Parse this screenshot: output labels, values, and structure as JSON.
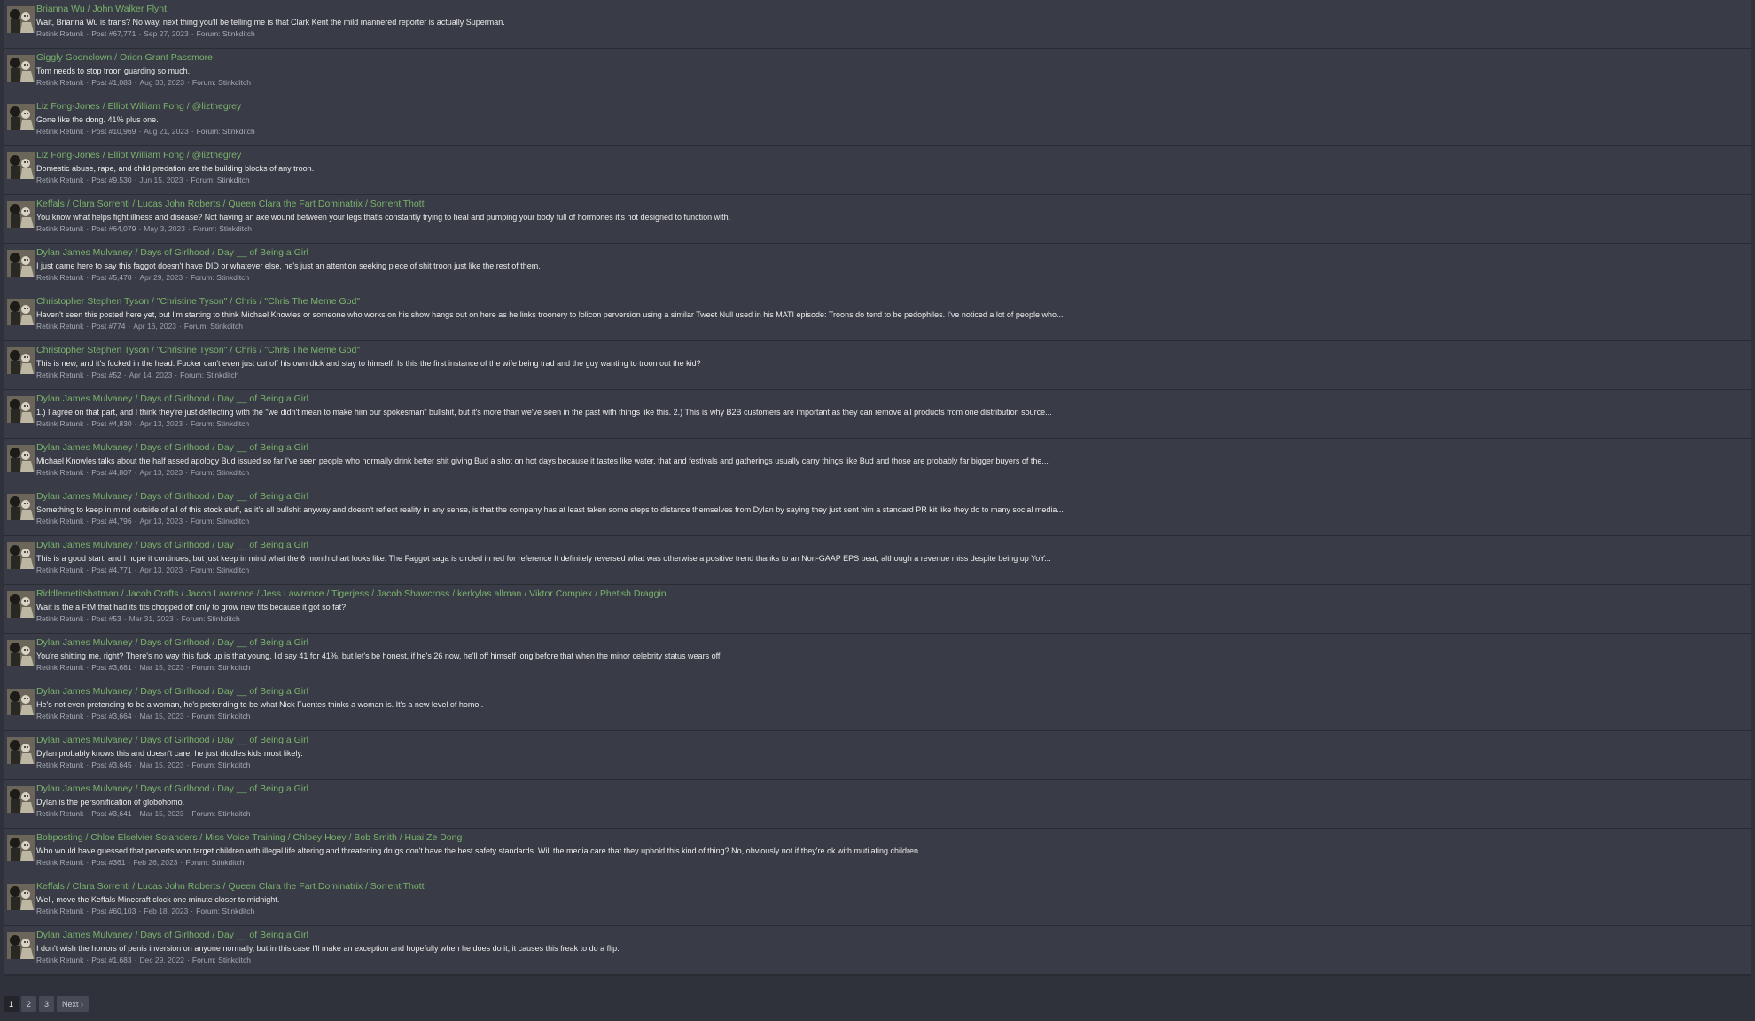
{
  "results": [
    {
      "title": "Brianna Wu / John Walker Flynt",
      "snippet": "Wait, Brianna Wu is trans? No way, next thing you'll be telling me is that Clark Kent the mild mannered reporter is actually Superman.",
      "author": "Retink Retunk",
      "post": "Post #67,771",
      "date": "Sep 27, 2023",
      "forum": "Forum: Stinkditch"
    },
    {
      "title": "Giggly Goonclown / Orion Grant Passmore",
      "snippet": "Tom needs to stop troon guarding so much.",
      "author": "Retink Retunk",
      "post": "Post #1,083",
      "date": "Aug 30, 2023",
      "forum": "Forum: Stinkditch"
    },
    {
      "title": "Liz Fong-Jones / Elliot William Fong / @lizthegrey",
      "snippet": "Gone like the dong. 41% plus one.",
      "author": "Retink Retunk",
      "post": "Post #10,969",
      "date": "Aug 21, 2023",
      "forum": "Forum: Stinkditch"
    },
    {
      "title": "Liz Fong-Jones / Elliot William Fong / @lizthegrey",
      "snippet": "Domestic abuse, rape, and child predation are the building blocks of any troon.",
      "author": "Retink Retunk",
      "post": "Post #9,530",
      "date": "Jun 15, 2023",
      "forum": "Forum: Stinkditch"
    },
    {
      "title": "Keffals / Clara Sorrenti / Lucas John Roberts / Queen Clara the Fart Dominatrix / SorrentiThott",
      "snippet": "You know what helps fight illness and disease? Not having an axe wound between your legs that's constantly trying to heal and pumping your body full of hormones it's not designed to function with.",
      "author": "Retink Retunk",
      "post": "Post #64,079",
      "date": "May 3, 2023",
      "forum": "Forum: Stinkditch"
    },
    {
      "title": "Dylan James Mulvaney / Days of Girlhood / Day __ of Being a Girl",
      "snippet": "I just came here to say this faggot doesn't have DID or whatever else, he's just an attention seeking piece of shit troon just like the rest of them.",
      "author": "Retink Retunk",
      "post": "Post #5,478",
      "date": "Apr 29, 2023",
      "forum": "Forum: Stinkditch"
    },
    {
      "title": "Christopher Stephen Tyson / \"Christine Tyson\" / Chris / \"Chris The Meme God\"",
      "snippet": "Haven't seen this posted here yet, but I'm starting to think Michael Knowles or someone who works on his show hangs out on here as he links troonery to lolicon perversion using a similar Tweet Null used in his MATI episode: Troons do tend to be pedophiles. I've noticed a lot of people who...",
      "author": "Retink Retunk",
      "post": "Post #774",
      "date": "Apr 16, 2023",
      "forum": "Forum: Stinkditch"
    },
    {
      "title": "Christopher Stephen Tyson / \"Christine Tyson\" / Chris / \"Chris The Meme God\"",
      "snippet": "This is new, and it's fucked in the head. Fucker can't even just cut off his own dick and stay to himself. Is this the first instance of the wife being trad and the guy wanting to troon out the kid?",
      "author": "Retink Retunk",
      "post": "Post #52",
      "date": "Apr 14, 2023",
      "forum": "Forum: Stinkditch"
    },
    {
      "title": "Dylan James Mulvaney / Days of Girlhood / Day __ of Being a Girl",
      "snippet": "1.) I agree on that part, and I think they're just deflecting with the \"we didn't mean to make him our spokesman\" bullshit, but it's more than we've seen in the past with things like this. 2.) This is why B2B customers are important as they can remove all products from one distribution source...",
      "author": "Retink Retunk",
      "post": "Post #4,830",
      "date": "Apr 13, 2023",
      "forum": "Forum: Stinkditch"
    },
    {
      "title": "Dylan James Mulvaney / Days of Girlhood / Day __ of Being a Girl",
      "snippet": "Michael Knowles talks about the half assed apology Bud issued so far I've seen people who normally drink better shit giving Bud a shot on hot days because it tastes like water, that and festivals and gatherings usually carry things like Bud and those are probably far bigger buyers of the...",
      "author": "Retink Retunk",
      "post": "Post #4,807",
      "date": "Apr 13, 2023",
      "forum": "Forum: Stinkditch"
    },
    {
      "title": "Dylan James Mulvaney / Days of Girlhood / Day __ of Being a Girl",
      "snippet": "Something to keep in mind outside of all of this stock stuff, as it's all bullshit anyway and doesn't reflect reality in any sense, is that the company has at least taken some steps to distance themselves from Dylan by saying they just sent him a standard PR kit like they do to many social media...",
      "author": "Retink Retunk",
      "post": "Post #4,796",
      "date": "Apr 13, 2023",
      "forum": "Forum: Stinkditch"
    },
    {
      "title": "Dylan James Mulvaney / Days of Girlhood / Day __ of Being a Girl",
      "snippet": "This is a good start, and I hope it continues, but just keep in mind what the 6 month chart looks like. The Faggot saga is circled in red for reference It definitely reversed what was otherwise a positive trend thanks to an Non-GAAP EPS beat, although a revenue miss despite being up YoY...",
      "author": "Retink Retunk",
      "post": "Post #4,771",
      "date": "Apr 13, 2023",
      "forum": "Forum: Stinkditch"
    },
    {
      "title": "Riddlemetitsbatman / Jacob Crafts / Jacob Lawrence / Jess Lawrence / Tigerjess / Jacob Shawcross / kerkylas allman / Viktor Complex / Phetish Draggin",
      "snippet": "Wait is the a FtM that had its tits chopped off only to grow new tits because it got so fat?",
      "author": "Retink Retunk",
      "post": "Post #53",
      "date": "Mar 31, 2023",
      "forum": "Forum: Stinkditch"
    },
    {
      "title": "Dylan James Mulvaney / Days of Girlhood / Day __ of Being a Girl",
      "snippet": "You're shitting me, right? There's no way this fuck up is that young. I'd say 41 for 41%, but let's be honest, if he's 26 now, he'll off himself long before that when the minor celebrity status wears off.",
      "author": "Retink Retunk",
      "post": "Post #3,681",
      "date": "Mar 15, 2023",
      "forum": "Forum: Stinkditch"
    },
    {
      "title": "Dylan James Mulvaney / Days of Girlhood / Day __ of Being a Girl",
      "snippet": "He's not even pretending to be a woman, he's pretending to be what Nick Fuentes thinks a woman is. It's a new level of homo..",
      "author": "Retink Retunk",
      "post": "Post #3,664",
      "date": "Mar 15, 2023",
      "forum": "Forum: Stinkditch"
    },
    {
      "title": "Dylan James Mulvaney / Days of Girlhood / Day __ of Being a Girl",
      "snippet": "Dylan probably knows this and doesn't care, he just diddles kids most likely.",
      "author": "Retink Retunk",
      "post": "Post #3,645",
      "date": "Mar 15, 2023",
      "forum": "Forum: Stinkditch"
    },
    {
      "title": "Dylan James Mulvaney / Days of Girlhood / Day __ of Being a Girl",
      "snippet": "Dylan is the personification of globohomo.",
      "author": "Retink Retunk",
      "post": "Post #3,641",
      "date": "Mar 15, 2023",
      "forum": "Forum: Stinkditch"
    },
    {
      "title": "Bobposting / Chloe Elselvier Solanders / Miss Voice Training / Chloey Hoey / Bob Smith / Huai Ze Dong",
      "snippet": "Who would have guessed that perverts who target children with illegal life altering and threatening drugs don't have the best safety standards. Will the media care that they uphold this kind of thing? No, obviously not if they're ok with mutilating children.",
      "author": "Retink Retunk",
      "post": "Post #361",
      "date": "Feb 26, 2023",
      "forum": "Forum: Stinkditch"
    },
    {
      "title": "Keffals / Clara Sorrenti / Lucas John Roberts / Queen Clara the Fart Dominatrix / SorrentiThott",
      "snippet": "Well, move the Keffals Minecraft clock one minute closer to midnight.",
      "author": "Retink Retunk",
      "post": "Post #60,103",
      "date": "Feb 18, 2023",
      "forum": "Forum: Stinkditch"
    },
    {
      "title": "Dylan James Mulvaney / Days of Girlhood / Day __ of Being a Girl",
      "snippet": "I don't wish the horrors of penis inversion on anyone normally, but in this case I'll make an exception and hopefully when he does do it, it causes this freak to do a flip.",
      "author": "Retink Retunk",
      "post": "Post #1,683",
      "date": "Dec 29, 2022",
      "forum": "Forum: Stinkditch"
    }
  ],
  "pagination": {
    "pages": [
      "1",
      "2",
      "3"
    ],
    "current": "1",
    "next_label": "Next ›"
  },
  "colors": {
    "page_bg": "#2f323b",
    "row_bg": "#393c46",
    "title_link": "#7ab26c",
    "snippet_text": "#ececec",
    "meta_text": "#9ea2ad"
  },
  "icons": {
    "avatar": "user-avatar-icon",
    "separator": "·"
  }
}
